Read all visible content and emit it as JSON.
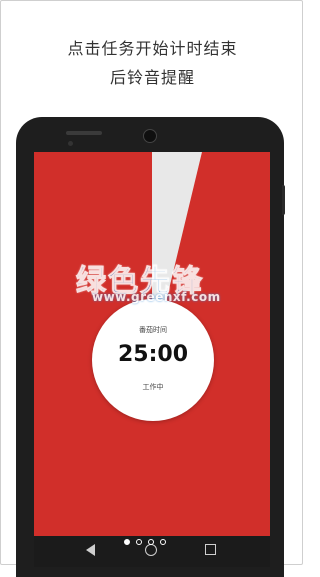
{
  "caption": {
    "line1": "点击任务开始计时结束",
    "line2": "后铃音提醒"
  },
  "timer": {
    "label": "番茄时间",
    "value": "25:00",
    "status": "工作中"
  },
  "watermark": {
    "title": "绿色先锋",
    "sub": "www.greenxf.com"
  },
  "pager": {
    "count": 4,
    "active_index": 0
  },
  "nav_icons": [
    "back-icon",
    "home-icon",
    "recent-apps-icon"
  ],
  "colors": {
    "screen_background": "#d12f2a",
    "wedge": "#e8e8e8",
    "timer_disc": "#ffffff"
  }
}
